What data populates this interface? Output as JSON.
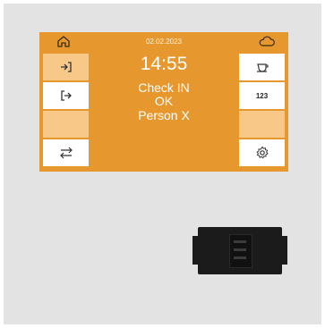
{
  "screen": {
    "date": "02.02.2023",
    "time": "14:55",
    "status_lines": [
      "Check IN",
      "OK",
      "Person X"
    ],
    "left_buttons": [
      {
        "icon": "login-arrow-icon"
      },
      {
        "icon": "logout-arrow-icon"
      },
      {
        "icon": "blank"
      },
      {
        "icon": "swap-arrows-icon"
      }
    ],
    "right_buttons": [
      {
        "icon": "coffee-cup-icon"
      },
      {
        "icon": "numeric-keypad-icon",
        "label": "123"
      },
      {
        "icon": "blank"
      },
      {
        "icon": "gear-icon"
      }
    ],
    "top_icons": [
      "home-icon",
      "cloud-icon"
    ]
  },
  "colors": {
    "screen_bg": "#e6982e",
    "highlight_button": "#f7c888",
    "panel": "#e3e3e3"
  }
}
